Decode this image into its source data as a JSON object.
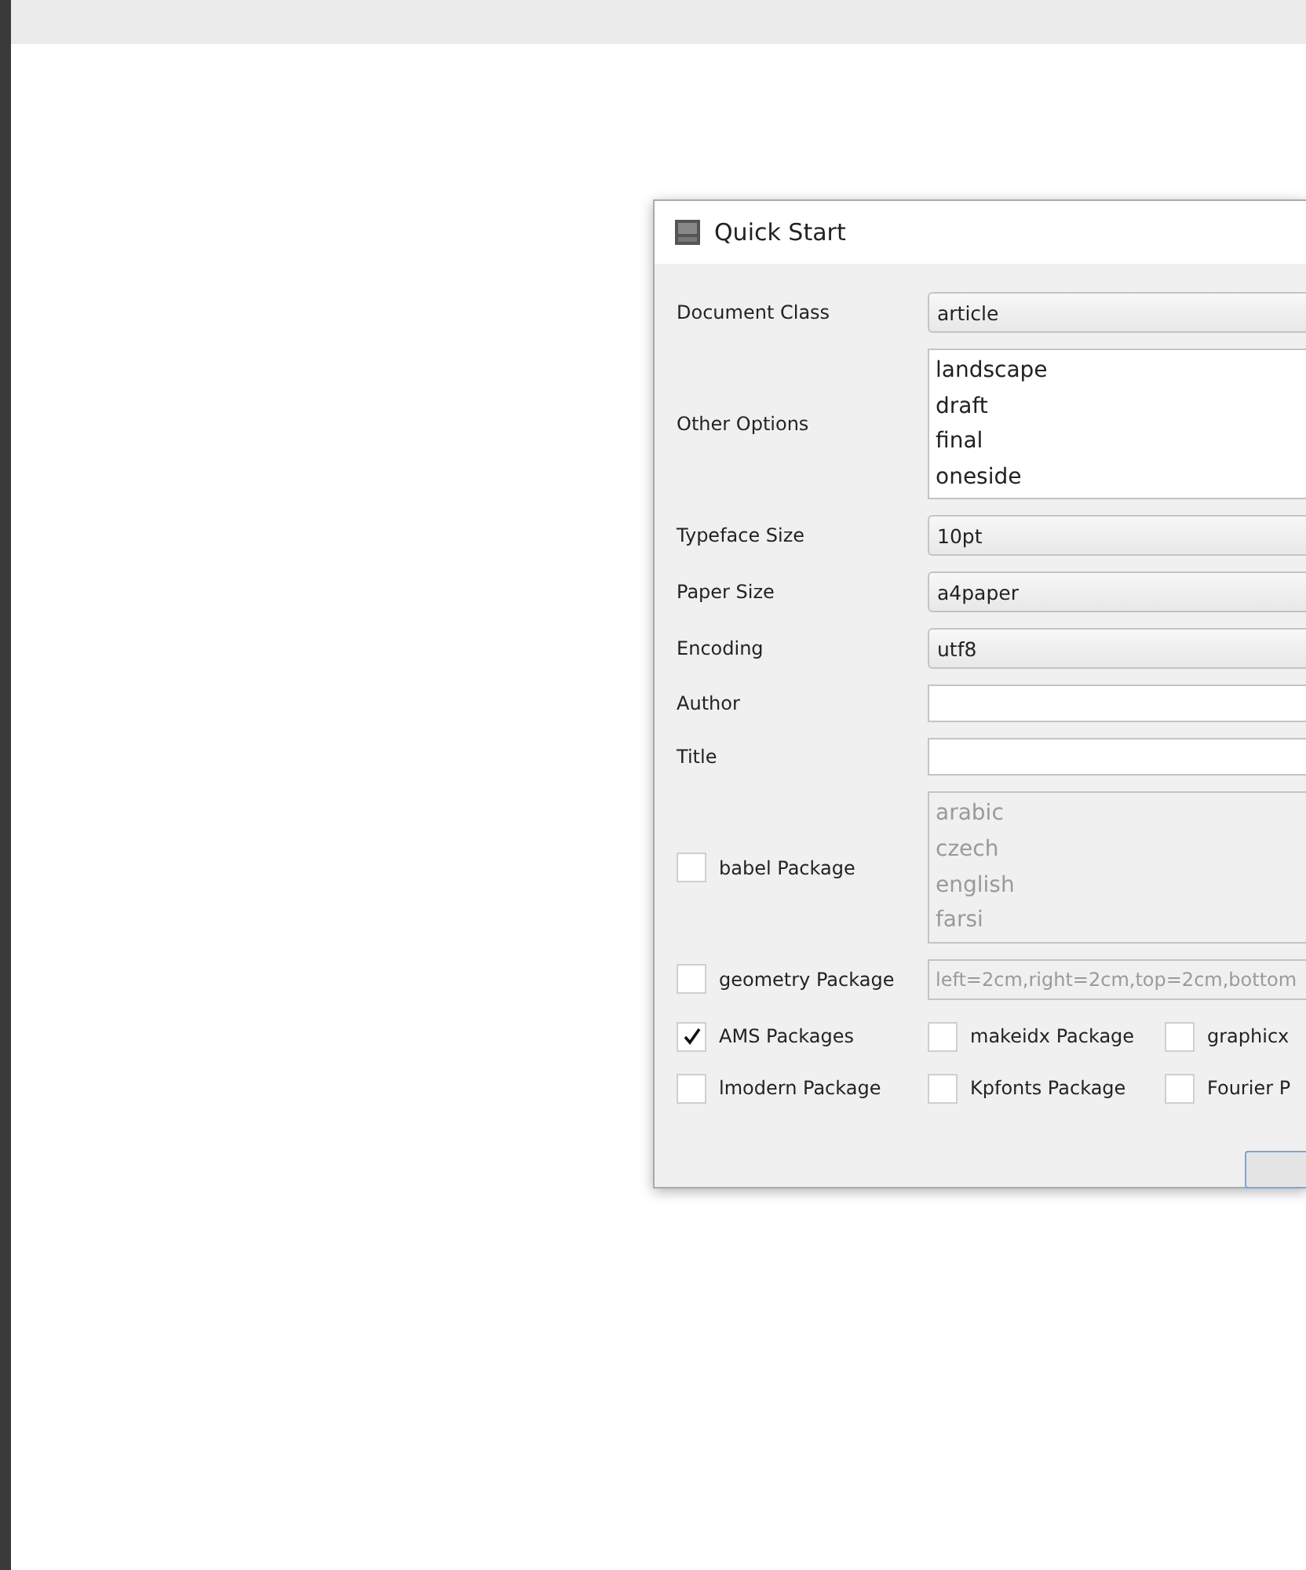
{
  "dialog": {
    "title": "Quick Start",
    "fields": [
      {
        "kind": "combo",
        "label": "Document Class",
        "value": "article"
      },
      {
        "kind": "list",
        "label": "Other Options",
        "items": [
          "landscape",
          "draft",
          "final",
          "oneside"
        ]
      },
      {
        "kind": "combo",
        "label": "Typeface Size",
        "value": "10pt"
      },
      {
        "kind": "combo",
        "label": "Paper Size",
        "value": "a4paper"
      },
      {
        "kind": "combo",
        "label": "Encoding",
        "value": "utf8"
      },
      {
        "kind": "text",
        "label": "Author"
      },
      {
        "kind": "text",
        "label": "Title"
      },
      {
        "kind": "checklist",
        "label": "babel Package",
        "checked": false,
        "items": [
          "arabic",
          "czech",
          "english",
          "farsi"
        ]
      },
      {
        "kind": "checktext",
        "label": "geometry Package",
        "checked": false,
        "value": "left=2cm,right=2cm,top=2cm,bottom"
      }
    ],
    "packages": [
      [
        {
          "label": "AMS Packages",
          "checked": true
        },
        {
          "label": "makeidx Package",
          "checked": false
        },
        {
          "label": "graphicx",
          "checked": false
        }
      ],
      [
        {
          "label": "lmodern Package",
          "checked": false
        },
        {
          "label": "Kpfonts Package",
          "checked": false
        },
        {
          "label": "Fourier P",
          "checked": false
        }
      ]
    ]
  }
}
